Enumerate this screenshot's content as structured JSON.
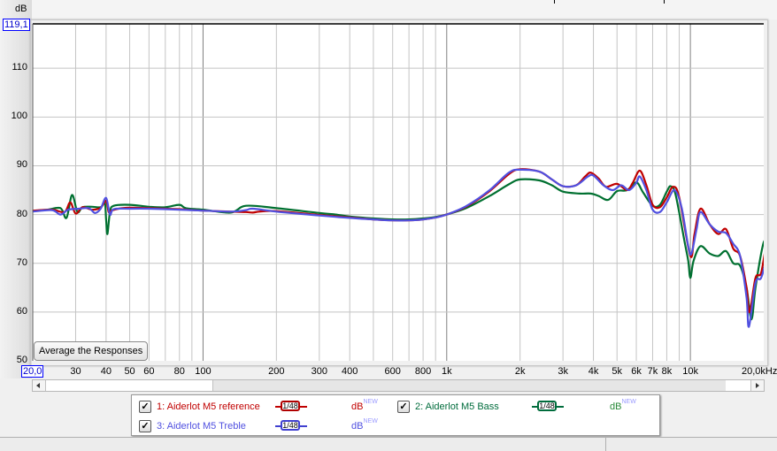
{
  "chart_data": {
    "type": "line",
    "title": "",
    "ylabel": "dB",
    "xlabel": "Hz",
    "xscale": "log",
    "xlim": [
      20,
      20000
    ],
    "ylim": [
      50,
      119.1
    ],
    "y_ticks": [
      "50",
      "60",
      "70",
      "80",
      "90",
      "100",
      "110"
    ],
    "y_top_box": "119,1",
    "x_left_box": "20,0",
    "x_ticks": [
      {
        "v": 30,
        "label": "30"
      },
      {
        "v": 40,
        "label": "40"
      },
      {
        "v": 50,
        "label": "50"
      },
      {
        "v": 60,
        "label": "60"
      },
      {
        "v": 80,
        "label": "80"
      },
      {
        "v": 100,
        "label": "100"
      },
      {
        "v": 200,
        "label": "200"
      },
      {
        "v": 300,
        "label": "300"
      },
      {
        "v": 400,
        "label": "400"
      },
      {
        "v": 600,
        "label": "600"
      },
      {
        "v": 800,
        "label": "800"
      },
      {
        "v": 1000,
        "label": "1k"
      },
      {
        "v": 2000,
        "label": "2k"
      },
      {
        "v": 3000,
        "label": "3k"
      },
      {
        "v": 4000,
        "label": "4k"
      },
      {
        "v": 5000,
        "label": "5k"
      },
      {
        "v": 6000,
        "label": "6k"
      },
      {
        "v": 7000,
        "label": "7k"
      },
      {
        "v": 8000,
        "label": "8k"
      },
      {
        "v": 10000,
        "label": "10k"
      }
    ],
    "x_end_label": "20,0kHz",
    "grid": true,
    "series": [
      {
        "name": "1: Aiderlot M5 reference",
        "color": "#c00000",
        "points": [
          [
            20,
            80.8
          ],
          [
            24,
            81
          ],
          [
            27,
            80.5
          ],
          [
            28.5,
            82.5
          ],
          [
            30,
            80.2
          ],
          [
            32,
            81.5
          ],
          [
            35,
            81
          ],
          [
            38,
            81.4
          ],
          [
            40,
            82.8
          ],
          [
            41,
            80.5
          ],
          [
            42,
            80.8
          ],
          [
            45,
            81.2
          ],
          [
            50,
            81.4
          ],
          [
            60,
            81.3
          ],
          [
            70,
            81.2
          ],
          [
            80,
            81.1
          ],
          [
            100,
            80.8
          ],
          [
            130,
            80.6
          ],
          [
            150,
            80.5
          ],
          [
            160,
            80.4
          ],
          [
            170,
            80.6
          ],
          [
            200,
            80.7
          ],
          [
            300,
            79.9
          ],
          [
            400,
            79.4
          ],
          [
            500,
            79
          ],
          [
            600,
            78.8
          ],
          [
            700,
            78.8
          ],
          [
            800,
            79
          ],
          [
            900,
            79.4
          ],
          [
            1000,
            80
          ],
          [
            1200,
            81.6
          ],
          [
            1500,
            84.8
          ],
          [
            1800,
            88.3
          ],
          [
            2000,
            89.3
          ],
          [
            2400,
            88.8
          ],
          [
            2700,
            87.2
          ],
          [
            3000,
            85.8
          ],
          [
            3400,
            86
          ],
          [
            3700,
            87.8
          ],
          [
            3900,
            88.6
          ],
          [
            4200,
            87.4
          ],
          [
            4500,
            85.7
          ],
          [
            5000,
            86.3
          ],
          [
            5500,
            85
          ],
          [
            5800,
            86.5
          ],
          [
            6200,
            89
          ],
          [
            6600,
            86
          ],
          [
            7000,
            82
          ],
          [
            7500,
            81.5
          ],
          [
            8000,
            83.5
          ],
          [
            8500,
            85.7
          ],
          [
            9000,
            83.5
          ],
          [
            10000,
            71.5
          ],
          [
            10400,
            76
          ],
          [
            11000,
            81.2
          ],
          [
            12000,
            78
          ],
          [
            13000,
            76
          ],
          [
            14000,
            77
          ],
          [
            15000,
            73
          ],
          [
            16000,
            71.5
          ],
          [
            17000,
            65
          ],
          [
            17500,
            60
          ],
          [
            18500,
            67
          ],
          [
            19500,
            68
          ],
          [
            20500,
            74
          ],
          [
            21500,
            78.2
          ],
          [
            22500,
            74.5
          ],
          [
            23000,
            73.5
          ]
        ]
      },
      {
        "name": "2: Aiderlot M5 Bass",
        "color": "#007030",
        "points": [
          [
            20,
            80.7
          ],
          [
            23,
            81
          ],
          [
            26,
            81.3
          ],
          [
            27.5,
            79.3
          ],
          [
            29,
            84
          ],
          [
            30.5,
            80.5
          ],
          [
            32,
            81.5
          ],
          [
            35,
            81.6
          ],
          [
            38,
            81.5
          ],
          [
            39.5,
            82.5
          ],
          [
            40,
            79
          ],
          [
            40.5,
            76
          ],
          [
            41.5,
            80.5
          ],
          [
            43,
            81.8
          ],
          [
            50,
            82
          ],
          [
            60,
            81.6
          ],
          [
            70,
            81.5
          ],
          [
            80,
            82
          ],
          [
            85,
            81.3
          ],
          [
            100,
            81
          ],
          [
            130,
            80.4
          ],
          [
            150,
            81.8
          ],
          [
            200,
            81.3
          ],
          [
            300,
            80.3
          ],
          [
            350,
            80
          ],
          [
            400,
            79.6
          ],
          [
            500,
            79.2
          ],
          [
            600,
            79
          ],
          [
            700,
            79
          ],
          [
            800,
            79.2
          ],
          [
            900,
            79.5
          ],
          [
            1000,
            80
          ],
          [
            1200,
            81.3
          ],
          [
            1500,
            83.8
          ],
          [
            1800,
            86.2
          ],
          [
            2000,
            87.2
          ],
          [
            2400,
            87
          ],
          [
            2700,
            86
          ],
          [
            3000,
            84.7
          ],
          [
            3500,
            84.3
          ],
          [
            3900,
            84.3
          ],
          [
            4200,
            83.8
          ],
          [
            4600,
            83
          ],
          [
            5000,
            84.8
          ],
          [
            5500,
            85
          ],
          [
            6000,
            86.6
          ],
          [
            6400,
            84.5
          ],
          [
            7000,
            81.8
          ],
          [
            7500,
            82
          ],
          [
            8000,
            84.7
          ],
          [
            8300,
            85.8
          ],
          [
            8700,
            84
          ],
          [
            9500,
            74
          ],
          [
            9800,
            70.5
          ],
          [
            10000,
            67
          ],
          [
            10300,
            70.5
          ],
          [
            11000,
            73.5
          ],
          [
            12000,
            72
          ],
          [
            13000,
            71.5
          ],
          [
            14000,
            72.5
          ],
          [
            15000,
            70
          ],
          [
            16000,
            69.5
          ],
          [
            17000,
            65
          ],
          [
            17800,
            58.5
          ],
          [
            18500,
            65
          ],
          [
            19800,
            73.5
          ],
          [
            20400,
            74.2
          ],
          [
            21200,
            71
          ],
          [
            22000,
            69
          ],
          [
            23000,
            71
          ]
        ]
      },
      {
        "name": "3: Aiderlot M5 Treble",
        "color": "#5050e0",
        "points": [
          [
            20,
            80.6
          ],
          [
            24,
            80.9
          ],
          [
            26,
            80
          ],
          [
            28,
            81
          ],
          [
            31,
            81.2
          ],
          [
            34,
            81.3
          ],
          [
            36,
            80.3
          ],
          [
            38,
            81.2
          ],
          [
            40,
            83.4
          ],
          [
            41.5,
            80
          ],
          [
            43,
            81.1
          ],
          [
            50,
            81.2
          ],
          [
            60,
            81.2
          ],
          [
            80,
            81
          ],
          [
            100,
            80.8
          ],
          [
            130,
            80.6
          ],
          [
            150,
            80.9
          ],
          [
            160,
            81.2
          ],
          [
            200,
            80.6
          ],
          [
            300,
            79.8
          ],
          [
            400,
            79.3
          ],
          [
            500,
            79
          ],
          [
            600,
            78.8
          ],
          [
            700,
            78.8
          ],
          [
            800,
            79
          ],
          [
            900,
            79.4
          ],
          [
            1000,
            80
          ],
          [
            1200,
            81.7
          ],
          [
            1500,
            85
          ],
          [
            1800,
            88.6
          ],
          [
            2000,
            89.2
          ],
          [
            2400,
            88.8
          ],
          [
            2700,
            87.2
          ],
          [
            3000,
            85.8
          ],
          [
            3400,
            86
          ],
          [
            3800,
            87.8
          ],
          [
            4000,
            88
          ],
          [
            4400,
            86
          ],
          [
            4800,
            85
          ],
          [
            5200,
            86
          ],
          [
            5600,
            85
          ],
          [
            6000,
            86.5
          ],
          [
            6200,
            87.8
          ],
          [
            6600,
            85
          ],
          [
            7000,
            81
          ],
          [
            7500,
            80.5
          ],
          [
            8000,
            82.5
          ],
          [
            8600,
            85
          ],
          [
            9200,
            81.5
          ],
          [
            9800,
            73.5
          ],
          [
            10100,
            72
          ],
          [
            10600,
            77
          ],
          [
            11000,
            80.5
          ],
          [
            12000,
            78
          ],
          [
            13000,
            76.5
          ],
          [
            14000,
            76.2
          ],
          [
            15000,
            74
          ],
          [
            16000,
            71.5
          ],
          [
            17000,
            63
          ],
          [
            17400,
            57
          ],
          [
            18500,
            66
          ],
          [
            19500,
            67
          ],
          [
            20500,
            71
          ],
          [
            21500,
            77.5
          ],
          [
            22500,
            74.8
          ],
          [
            23000,
            74.5
          ]
        ]
      }
    ]
  },
  "button": {
    "average_label": "Average the Responses"
  },
  "legend": {
    "items": [
      {
        "label": "1: Aiderlot M5 reference",
        "color": "#c00000",
        "checked": "✓",
        "smoothing": "1/48",
        "units": "dB",
        "badge": "NEW"
      },
      {
        "label": "2: Aiderlot M5 Bass",
        "color": "#006c3c",
        "checked": "✓",
        "smoothing": "1/48",
        "units": "dB",
        "badge": "NEW"
      },
      {
        "label": "3: Aiderlot M5 Treble",
        "color": "#5050e0",
        "checked": "✓",
        "smoothing": "1/48",
        "units": "dB",
        "badge": "NEW"
      }
    ]
  }
}
